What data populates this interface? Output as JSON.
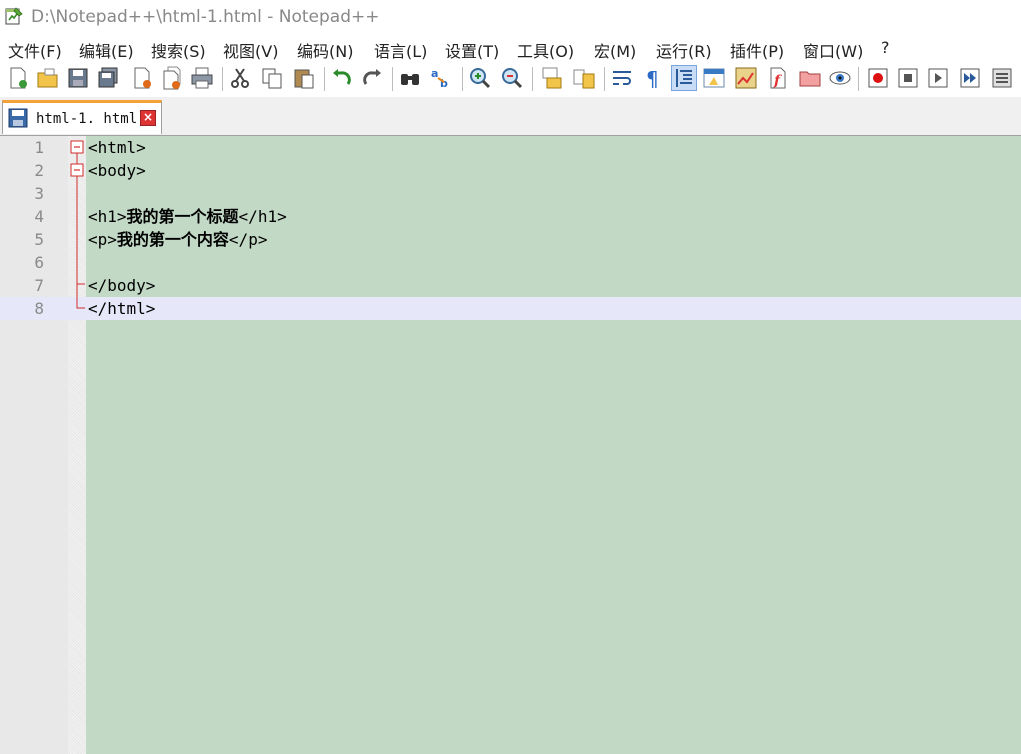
{
  "window": {
    "title": "D:\\Notepad++\\html-1.html - Notepad++"
  },
  "menu": [
    "文件(F)",
    "编辑(E)",
    "搜索(S)",
    "视图(V)",
    "编码(N)",
    "语言(L)",
    "设置(T)",
    "工具(O)",
    "宏(M)",
    "运行(R)",
    "插件(P)",
    "窗口(W)",
    "?"
  ],
  "toolbar": {
    "icons": [
      "new-file-icon",
      "open-file-icon",
      "save-icon",
      "save-all-icon",
      "close-icon",
      "close-all-icon",
      "print-icon",
      "cut-icon",
      "copy-icon",
      "paste-icon",
      "undo-icon",
      "redo-icon",
      "find-icon",
      "replace-icon",
      "zoom-in-icon",
      "zoom-out-icon",
      "sync-vertical-icon",
      "sync-horizontal-icon",
      "word-wrap-icon",
      "show-all-chars-icon",
      "indent-guide-icon",
      "udl-icon",
      "document-map-icon",
      "function-list-icon",
      "folder-workspace-icon",
      "monitoring-icon",
      "record-macro-icon",
      "stop-macro-icon",
      "play-macro-icon",
      "run-macro-multiple-icon",
      "save-macro-icon"
    ]
  },
  "tabs": [
    {
      "label": "html-1. html",
      "close": "×"
    }
  ],
  "editor": {
    "colors": {
      "background": "#c2d9c6",
      "gutter": "#e8e8e8",
      "current_line": "#e6e8fa",
      "fold_marker": "#d12b2b"
    },
    "current_line": 8,
    "lines": [
      {
        "n": "1",
        "pre": "<html>",
        "bold": "",
        "post": ""
      },
      {
        "n": "2",
        "pre": "<body>",
        "bold": "",
        "post": ""
      },
      {
        "n": "3",
        "pre": "",
        "bold": "",
        "post": ""
      },
      {
        "n": "4",
        "pre": "<h1>",
        "bold": "我的第一个标题",
        "post": "</h1>"
      },
      {
        "n": "5",
        "pre": "<p>",
        "bold": "我的第一个内容",
        "post": "</p>"
      },
      {
        "n": "6",
        "pre": "",
        "bold": "",
        "post": ""
      },
      {
        "n": "7",
        "pre": "</body>",
        "bold": "",
        "post": ""
      },
      {
        "n": "8",
        "pre": "</html>",
        "bold": "",
        "post": ""
      }
    ]
  }
}
